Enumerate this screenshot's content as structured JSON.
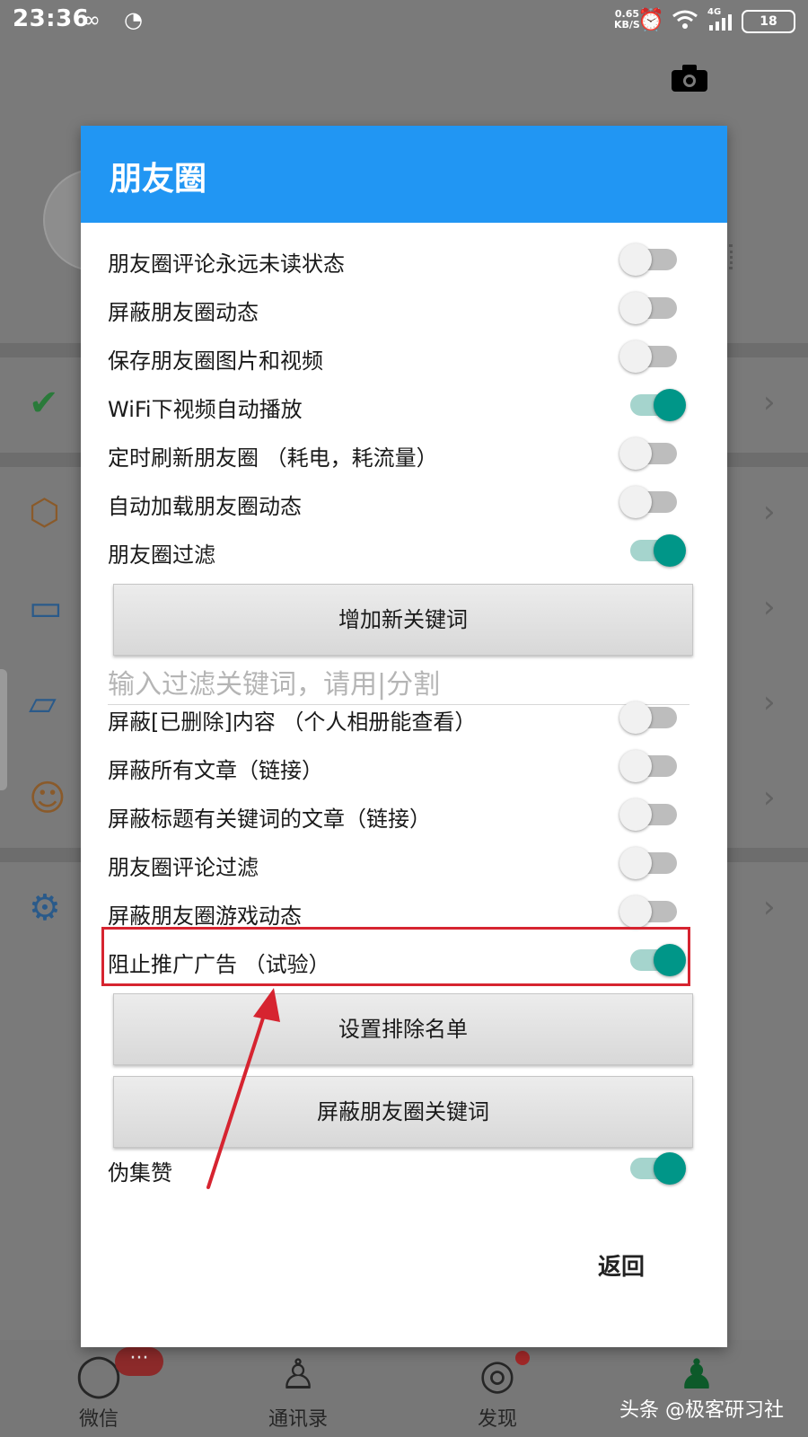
{
  "status_bar": {
    "time": "23:36",
    "speed_value": "0.65",
    "speed_unit": "KB/S",
    "network": "4G",
    "battery": "18"
  },
  "background_nav": {
    "items": [
      {
        "label": "微信",
        "icon": "chat-icon",
        "badge": "···"
      },
      {
        "label": "通讯录",
        "icon": "contacts-icon"
      },
      {
        "label": "发现",
        "icon": "compass-icon"
      },
      {
        "label": "",
        "icon": "me-icon"
      }
    ]
  },
  "watermark": "头条 @极客研习社",
  "dialog": {
    "title": "朋友圈",
    "rows_top": [
      {
        "label": "朋友圈评论永远未读状态",
        "on": false
      },
      {
        "label": "屏蔽朋友圈动态",
        "on": false
      },
      {
        "label": "保存朋友圈图片和视频",
        "on": false
      },
      {
        "label": "WiFi下视频自动播放",
        "on": true
      },
      {
        "label": "定时刷新朋友圈 （耗电，耗流量）",
        "on": false
      },
      {
        "label": "自动加载朋友圈动态",
        "on": false
      },
      {
        "label": "朋友圈过滤",
        "on": true
      }
    ],
    "add_keyword_button": "增加新关键词",
    "keyword_input_placeholder": "输入过滤关键词，请用|分割",
    "keyword_input_value": "",
    "rows_mid": [
      {
        "label": "屏蔽[已删除]内容 （个人相册能查看）",
        "on": false
      },
      {
        "label": "屏蔽所有文章（链接）",
        "on": false
      },
      {
        "label": "屏蔽标题有关键词的文章（链接）",
        "on": false
      },
      {
        "label": "朋友圈评论过滤",
        "on": false
      },
      {
        "label": "屏蔽朋友圈游戏动态",
        "on": false
      },
      {
        "label": "阻止推广广告 （试验）",
        "on": true
      }
    ],
    "exclude_list_button": "设置排除名单",
    "block_keyword_button": "屏蔽朋友圈关键词",
    "rows_bottom": [
      {
        "label": "伪集赞",
        "on": true
      }
    ],
    "return_button": "返回"
  },
  "colors": {
    "header": "#2196f3",
    "switch_on": "#009688",
    "highlight": "#d62430"
  }
}
